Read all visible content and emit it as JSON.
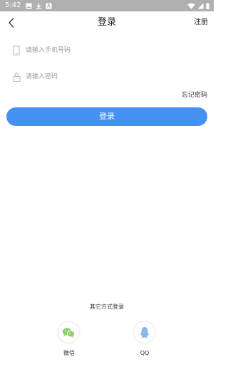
{
  "status_bar": {
    "time": "5:42",
    "icons": [
      "image-icon",
      "download-icon",
      "notification-icon"
    ],
    "right_icons": [
      "wifi-icon",
      "signal-icon",
      "battery-icon"
    ]
  },
  "header": {
    "title": "登录",
    "register": "注册"
  },
  "form": {
    "phone_placeholder": "请输入手机号码",
    "password_placeholder": "请输入密码",
    "forgot_password": "忘记密码",
    "login_button": "登录"
  },
  "other_login": {
    "title": "其它方式登录",
    "options": [
      {
        "label": "微信",
        "icon": "wechat-icon",
        "color": "#8bd06a"
      },
      {
        "label": "QQ",
        "icon": "qq-icon",
        "color": "#8ab8ef"
      }
    ]
  },
  "colors": {
    "status_bar": "#b0b0b0",
    "primary": "#4690f3",
    "placeholder": "#9a9a9a"
  }
}
